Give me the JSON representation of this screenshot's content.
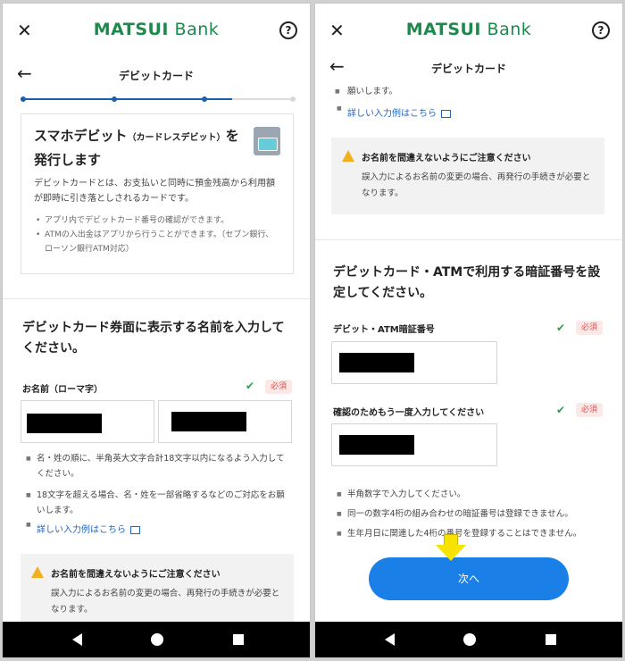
{
  "app": {
    "logo_bold": "MATSUI",
    "logo_regular": " Bank"
  },
  "nav": {
    "title": "デビットカード"
  },
  "colors": {
    "brand_green": "#1c8a4c",
    "primary_blue": "#1a7fe6",
    "link_blue": "#1a66c9",
    "required_red": "#d9534f",
    "warning_yellow": "#f2b01e"
  },
  "icons": {
    "close": "close-icon",
    "help": "help-icon",
    "back": "back-arrow-icon",
    "check": "checkmark-icon",
    "warning": "warning-icon",
    "external": "external-link-icon"
  },
  "left": {
    "progress": {
      "steps": 4,
      "current": 3,
      "fraction": 0.77
    },
    "card": {
      "title": "スマホデビット",
      "title_small": "（カードレスデビット）",
      "title_end": "を発行します",
      "desc": "デビットカードとは、お支払いと同時に預金残高から利用額が即時に引き落としされるカードです。",
      "bullets": [
        "アプリ内でデビットカード番号の確認ができます。",
        "ATMの入出金はアプリから行うことができます。（セブン銀行、ローソン銀行ATM対応）"
      ]
    },
    "name_section": {
      "title": "デビットカード券面に表示する名前を入力してください。",
      "label": "お名前（ローマ字）",
      "check": "✔",
      "required": "必須",
      "notes": [
        "名・姓の順に、半角英大文字合計18文字以内になるよう入力してください。",
        "18文字を超える場合、名・姓を一部省略するなどのご対応をお願いします。"
      ],
      "link": "詳しい入力例はこちら"
    },
    "warning": {
      "title": "お名前を間違えないようにご注意ください",
      "body": "誤入力によるお名前の変更の場合、再発行の手続きが必要となります。"
    }
  },
  "right": {
    "top_text": "願いします。",
    "link": "詳しい入力例はこちら",
    "warning": {
      "title": "お名前を間違えないようにご注意ください",
      "body": "誤入力によるお名前の変更の場合、再発行の手続きが必要となります。"
    },
    "pin_section": {
      "title": "デビットカード・ATMで利用する暗証番号を設定してください。",
      "pin_label": "デビット・ATM暗証番号",
      "confirm_label": "確認のためもう一度入力してください",
      "check": "✔",
      "required": "必須",
      "notes": [
        "半角数字で入力してください。",
        "同一の数字4桁の組み合わせの暗証番号は登録できません。",
        "生年月日に関連した4桁の番号を登録することはできません。"
      ]
    },
    "next_button": "次へ"
  }
}
